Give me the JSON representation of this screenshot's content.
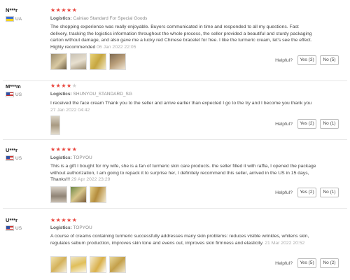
{
  "helpful_label": "Helpful?",
  "logistics_label": "Logistics:",
  "reviews": [
    {
      "user": "N***r",
      "country": "UA",
      "stars": 5,
      "logistics": "Cainiao Standard For Special Goods",
      "text": "The shopping experience was really enjoyable. Buyers communicated in time and responded to all my questions. Fast delivery, tracking the logistics information throughout the whole process, the seller provided a beautiful and sturdy packaging carton without damage, and also gave me a lucky red Chinese bracelet for free. I like the turmeric cream, let's see the effect. Highly recommended",
      "date": "06 Jan 2022 22:05",
      "yes": "Yes (3)",
      "no": "No (5)"
    },
    {
      "user": "M***m",
      "country": "US",
      "stars": 4,
      "logistics": "SHUNYOU_STANDARD_SG",
      "text": "I received the face cream Thank you to the seller and arrive earlier than expected I go to the try and I become you thank you",
      "date": "27 Jan 2022 04:42",
      "yes": "Yes (2)",
      "no": "No (1)"
    },
    {
      "user": "U***r",
      "country": "US",
      "stars": 5,
      "logistics": "TOPYOU",
      "text": "This is a gift I bought for my wife, she is a fan of turmeric skin care products. the seller filled it with raffia, I opened the package without authorization, I am going to repack it to surprise her, I definitely recommend this seller, arrived in the US in 15 days, Thanks!!!",
      "date": "29 Apr 2022 23:29",
      "yes": "Yes (2)",
      "no": "No (1)"
    },
    {
      "user": "U***r",
      "country": "US",
      "stars": 5,
      "logistics": "TOPYOU",
      "text": "A course of creams containing turmeric successfully addresses many skin problems: reduces visible wrinkles, whitens skin, regulates sebum production, improves skin tone and evens out, improves skin firmness and elasticity.",
      "date": "21 Mar 2022 20:52",
      "yes": "Yes (5)",
      "no": "No (2)"
    }
  ]
}
